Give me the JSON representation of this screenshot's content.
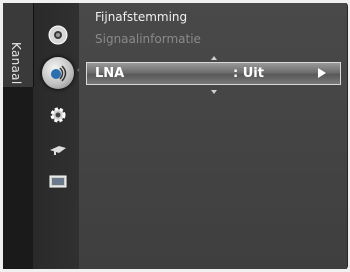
{
  "sidebar": {
    "tab_label": "Kanaal",
    "icons": [
      {
        "name": "picture-icon"
      },
      {
        "name": "channel-icon"
      },
      {
        "name": "setup-icon"
      },
      {
        "name": "input-icon"
      },
      {
        "name": "application-icon"
      }
    ]
  },
  "menu": {
    "items": [
      {
        "label": "Fijnafstemming",
        "enabled": true
      },
      {
        "label": "Signaalinformatie",
        "enabled": false
      }
    ],
    "selected": {
      "label": "LNA",
      "value": ": Uit"
    }
  },
  "colors": {
    "background": "#1d1d1f",
    "panel": "#454545",
    "highlight": "#7a7a7a",
    "disabled_text": "#8a8a8a"
  }
}
